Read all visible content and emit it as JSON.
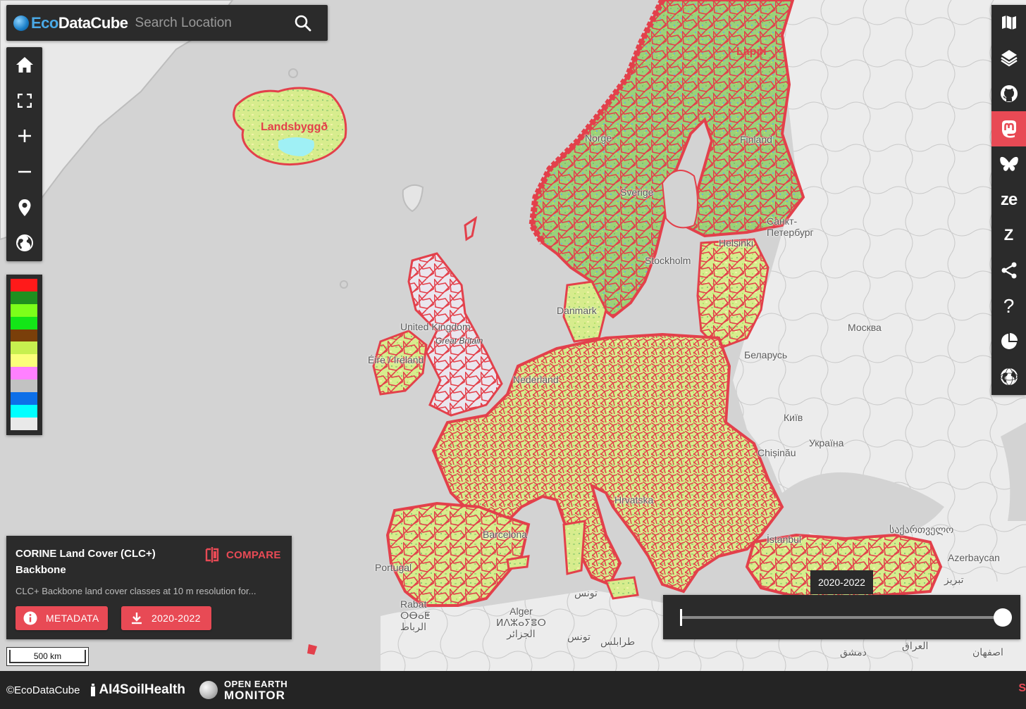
{
  "app": {
    "logo_part1": "Eco",
    "logo_part2": "DataCube",
    "search_placeholder": "Search Location"
  },
  "left_toolbar": {
    "items": [
      {
        "name": "home-icon"
      },
      {
        "name": "fullscreen-icon"
      },
      {
        "name": "zoom-in-icon"
      },
      {
        "name": "zoom-out-icon"
      },
      {
        "name": "location-pin-icon"
      },
      {
        "name": "globe-icon"
      }
    ]
  },
  "legend": {
    "colors": [
      "#ff1a1a",
      "#1f8f1f",
      "#7cff1a",
      "#13e617",
      "#7a3f0a",
      "#c7ef4f",
      "#fbff7a",
      "#ff80ff",
      "#c2c2c2",
      "#0d6fe8",
      "#00ffff",
      "#e9e9e9"
    ]
  },
  "right_toolbar": {
    "items": [
      {
        "name": "map-icon"
      },
      {
        "name": "layers-icon"
      },
      {
        "name": "github-icon"
      },
      {
        "name": "mastodon-icon",
        "active": true
      },
      {
        "name": "bluesky-icon"
      },
      {
        "name": "zenodo-icon",
        "text": "ze"
      },
      {
        "name": "z-icon",
        "text": "Z"
      },
      {
        "name": "share-icon"
      },
      {
        "name": "help-icon",
        "text": "?"
      },
      {
        "name": "pie-chart-icon"
      },
      {
        "name": "globe-grid-icon"
      }
    ]
  },
  "info_panel": {
    "title": "CORINE Land Cover (CLC+) Backbone",
    "compare_label": "COMPARE",
    "description": "CLC+ Backbone land cover classes at 10 m resolution for...",
    "metadata_label": "METADATA",
    "download_label": "2020-2022"
  },
  "scale_bar": {
    "label": "500 km"
  },
  "time_slider": {
    "tooltip": "2020-2022",
    "value_fraction": 1.0
  },
  "footer": {
    "copyright": "©EcoDataCube",
    "ai4soil": "AI4SoilHealth",
    "oem_line1": "OPEN EARTH",
    "oem_line2": "MONITOR",
    "right_fragment": "S"
  },
  "map_labels": {
    "lappi": "Lappi",
    "landsbyggd": "Landsbyggð",
    "norge": "Norge",
    "sverige": "Sverige",
    "finland": "Finland",
    "spb": "Санкт-\nПетербург",
    "helsinki": "Helsinki",
    "stockholm": "Stockholm",
    "moskva": "Москва",
    "united_kingdom": "United Kingdom",
    "great_britain": "Great Britain",
    "eire": "Éire / Ireland",
    "danmark": "Danmark",
    "belarus": "Беларусь",
    "kyiv": "Київ",
    "ukraina": "Україна",
    "chisinau": "Chișinău",
    "georgia": "საქართველო",
    "azerbaycan": "Azerbaycan",
    "istanbul": "İstanbul",
    "barcelona": "Barcelona",
    "portugal": "Portugal",
    "rabat": "Rabat\nⵔⴱⴰⵟ\nالرباط",
    "alger": "Alger\nⵍⴷⵣⴰⵢⴻⵔ\nالجزائر",
    "tunis": "تونس",
    "tunis2": "تونس",
    "tarabulus": "طرابلس",
    "iraq": "العراق",
    "dimashq": "دمشق",
    "tabriz": "تبریز",
    "isfahan": "اصفهان",
    "hrvatska": "Hrvatska",
    "nederland": "Nederland"
  }
}
